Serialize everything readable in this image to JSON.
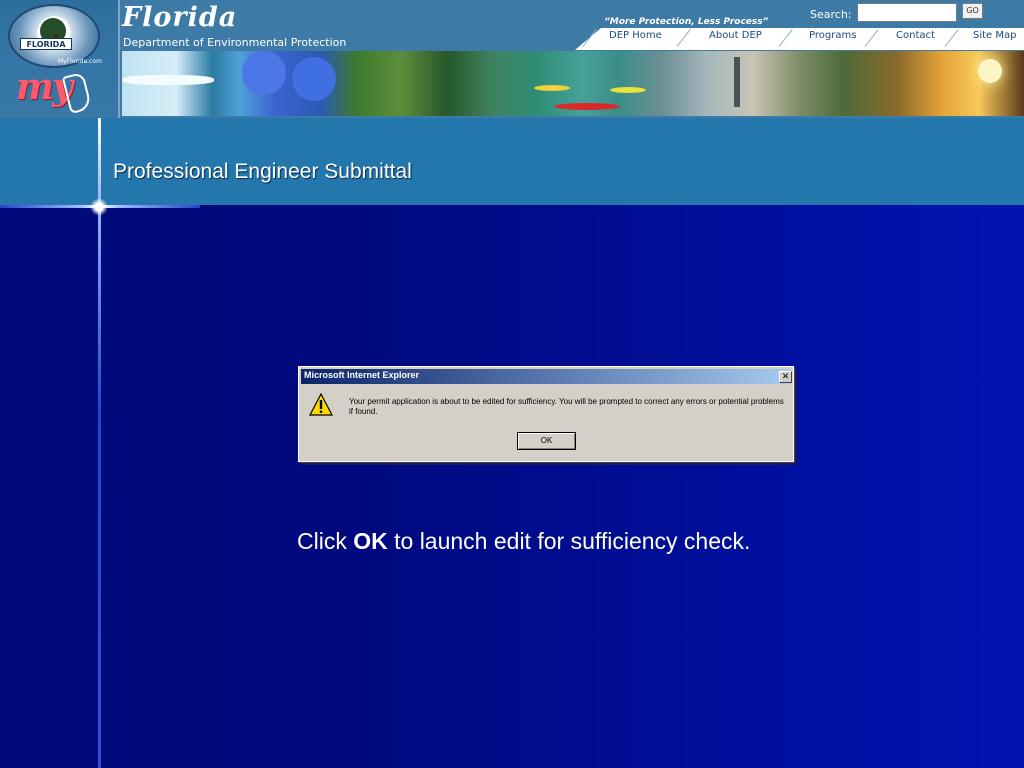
{
  "header": {
    "logo": {
      "seal_text": "FLORIDA",
      "url_text": "MyFlorida.com",
      "brand": "my"
    },
    "title": "Florida",
    "department": "Department of Environmental Protection",
    "tagline": "“More Protection, Less Process”",
    "search": {
      "label": "Search:",
      "value": "",
      "go_label": "GO"
    },
    "nav": [
      {
        "label": "DEP Home"
      },
      {
        "label": "About DEP"
      },
      {
        "label": "Programs"
      },
      {
        "label": "Contact"
      },
      {
        "label": "Site Map"
      }
    ]
  },
  "page": {
    "title": "Professional Engineer Submittal"
  },
  "dialog": {
    "title": "Microsoft Internet Explorer",
    "close_glyph": "✕",
    "icon": "warning-icon",
    "message": "Your permit application is about to be edited for sufficiency.  You will be prompted to correct any errors or potential problems if found.",
    "ok_label": "OK"
  },
  "instruction": {
    "prefix": "Click ",
    "emphasis": "OK",
    "suffix": " to launch edit for sufficiency check."
  },
  "colors": {
    "background": "#00097e",
    "title_band": "#2377ad",
    "header": "#3e7aa6",
    "dialog_face": "#d4d0c8",
    "dialog_titlebar": "#0a246a"
  }
}
